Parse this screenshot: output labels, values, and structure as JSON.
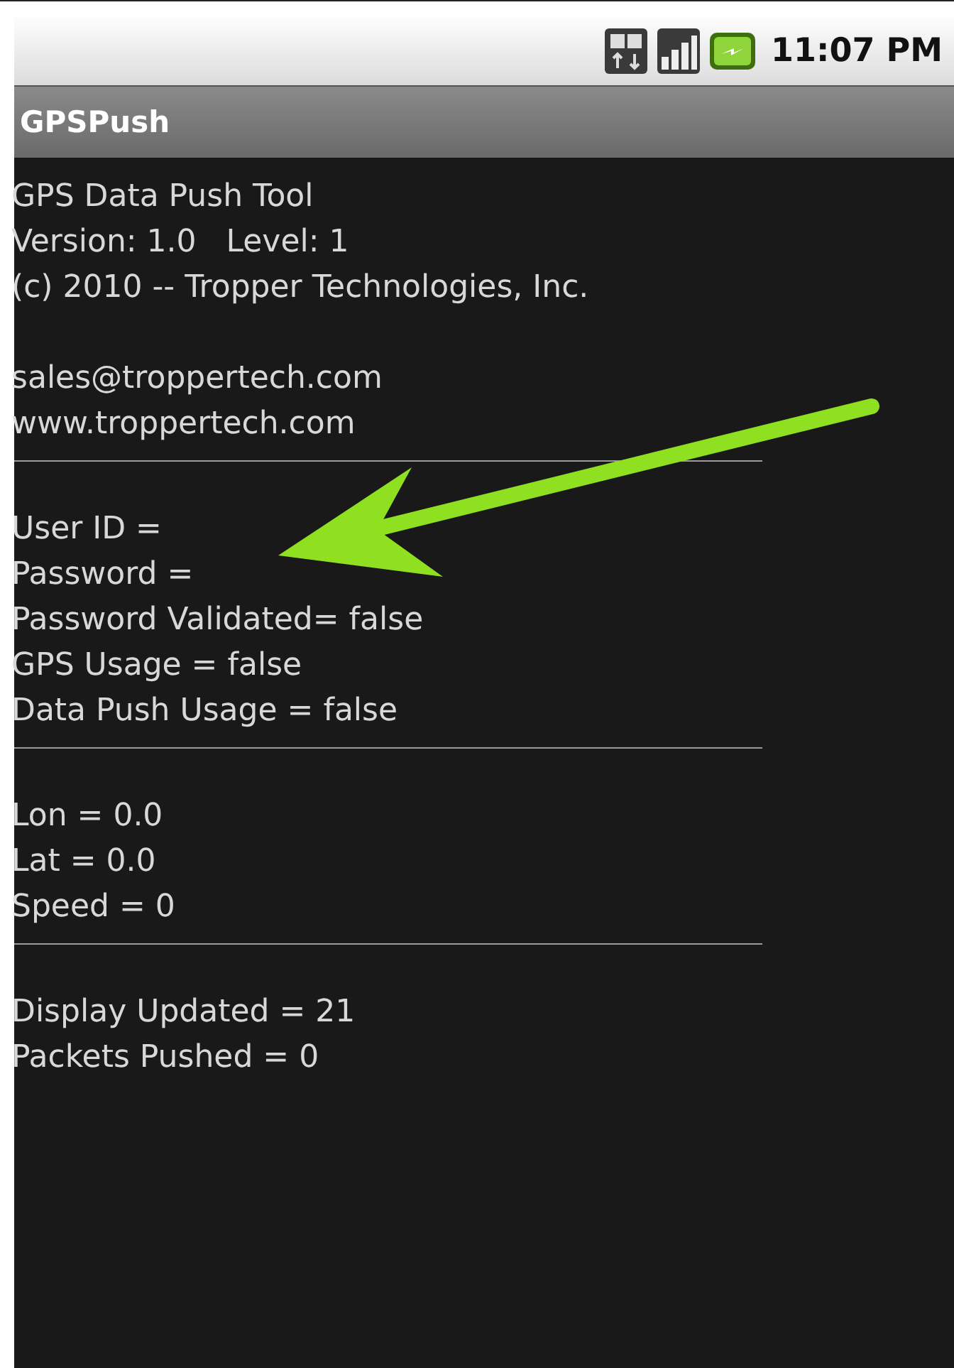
{
  "status_bar": {
    "time": "11:07 PM"
  },
  "app_title": "GPSPush",
  "blocks": [
    {
      "kind": "text",
      "lines": [
        "GPS Data Push Tool",
        "Version: 1.0   Level: 1",
        "(c) 2010 -- Tropper Technologies, Inc."
      ]
    },
    {
      "kind": "gap"
    },
    {
      "kind": "text",
      "lines": [
        "sales@troppertech.com",
        "www.troppertech.com"
      ]
    },
    {
      "kind": "rule"
    },
    {
      "kind": "gap"
    },
    {
      "kind": "text",
      "lines": [
        "User ID =",
        "Password =",
        "Password Validated= false",
        "GPS Usage = false",
        "Data Push Usage = false"
      ]
    },
    {
      "kind": "rule"
    },
    {
      "kind": "gap"
    },
    {
      "kind": "text",
      "lines": [
        "Lon = 0.0",
        "Lat = 0.0",
        "Speed = 0"
      ]
    },
    {
      "kind": "rule"
    },
    {
      "kind": "gap"
    },
    {
      "kind": "text",
      "lines": [
        "Display Updated = 21",
        "Packets Pushed = 0"
      ]
    }
  ]
}
